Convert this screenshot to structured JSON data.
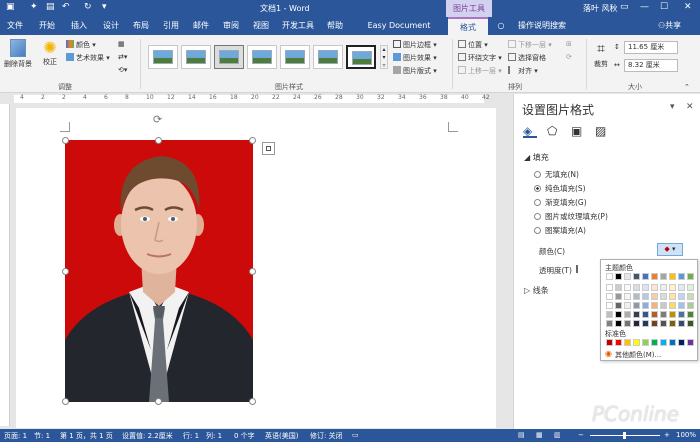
{
  "titlebar": {
    "doc_title": "文档1 - Word",
    "tool_context": "图片工具",
    "user": "落叶 风秋",
    "restore_icon": "restore-icon",
    "min_icon": "minimize-icon",
    "max_icon": "maximize-icon",
    "close_icon": "close-icon"
  },
  "tabs": [
    {
      "label": "文件"
    },
    {
      "label": "开始"
    },
    {
      "label": "插入"
    },
    {
      "label": "设计"
    },
    {
      "label": "布局"
    },
    {
      "label": "引用"
    },
    {
      "label": "邮件"
    },
    {
      "label": "审阅"
    },
    {
      "label": "视图"
    },
    {
      "label": "开发工具"
    },
    {
      "label": "帮助"
    },
    {
      "label": "Easy Document Creator"
    },
    {
      "label": "格式"
    }
  ],
  "tell_me": "操作说明搜索",
  "share": "共享",
  "ribbon": {
    "remove_bg": "删除背景",
    "corrections": "校正",
    "color": "颜色",
    "artistic": "艺术效果",
    "adjust_group": "调整",
    "styles_group": "图片样式",
    "picture_border": "图片边框",
    "picture_effects": "图片效果",
    "picture_layout": "图片版式",
    "position": "位置",
    "wrap_text": "环绕文字",
    "bring_forward": "上移一层",
    "send_backward": "下移一层",
    "selection_pane": "选择窗格",
    "align": "对齐",
    "arrange_group": "排列",
    "crop": "裁剪",
    "height": "11.65 厘米",
    "width": "8.32 厘米",
    "size_group": "大小"
  },
  "ruler_numbers": [
    "4",
    "2",
    "2",
    "4",
    "6",
    "8",
    "10",
    "12",
    "14",
    "16",
    "18",
    "20",
    "22",
    "24",
    "26",
    "28",
    "30",
    "32",
    "34",
    "36",
    "38",
    "40",
    "42"
  ],
  "pane": {
    "title": "设置图片格式",
    "fill_header": "填充",
    "options": [
      {
        "label": "无填充(N)",
        "selected": false
      },
      {
        "label": "纯色填充(S)",
        "selected": true
      },
      {
        "label": "渐变填充(G)",
        "selected": false
      },
      {
        "label": "图片或纹理填充(P)",
        "selected": false
      },
      {
        "label": "图案填充(A)",
        "selected": false
      }
    ],
    "color_label": "颜色(C)",
    "transparency_label": "透明度(T)",
    "line_header": "线条"
  },
  "palette": {
    "theme_label": "主题颜色",
    "standard_label": "标准色",
    "more_colors": "其他颜色(M)...",
    "theme_top": [
      "#ffffff",
      "#000000",
      "#e7e6e6",
      "#44546a",
      "#4472c4",
      "#ed7d31",
      "#a5a5a5",
      "#ffc000",
      "#5b9bd5",
      "#70ad47"
    ],
    "standard": [
      "#c00000",
      "#ff0000",
      "#ffc000",
      "#ffff00",
      "#92d050",
      "#00b050",
      "#00b0f0",
      "#0070c0",
      "#002060",
      "#7030a0"
    ]
  },
  "status": {
    "page": "页面: 1",
    "section": "节: 1",
    "page_of": "第 1 页，共 1 页",
    "set_value": "设置值: 2.2厘米",
    "row": "行: 1",
    "col": "列: 1",
    "words": "0 个字",
    "lang": "英语(美国)",
    "track": "修订: 关闭",
    "zoom": "100%"
  },
  "watermark": "PConline"
}
